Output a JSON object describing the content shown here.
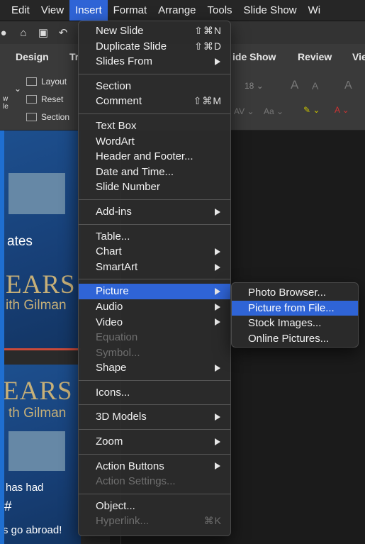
{
  "menubar": {
    "items": [
      "Edit",
      "View",
      "Insert",
      "Format",
      "Arrange",
      "Tools",
      "Slide Show",
      "Wi"
    ],
    "active": "Insert"
  },
  "ribbon": {
    "tabs": [
      "Design",
      "Tr",
      "ide Show",
      "Review",
      "Vie"
    ],
    "buttons": {
      "layout": "Layout",
      "reset": "Reset",
      "section": "Section",
      "new_line1": "w",
      "new_line2": "le"
    },
    "font_size": "18"
  },
  "slides": {
    "slide1_text": "ates",
    "slide1_years": "EARS",
    "slide1_sub": "ith Gilman",
    "slide2_years": "EARS",
    "slide2_sub": "th Gilman",
    "slide2_line1": "has had",
    "slide2_hash": "#",
    "slide2_line2": "s go abroad!"
  },
  "insert_menu": {
    "groups": [
      [
        {
          "label": "New Slide",
          "shortcut": "⇧⌘N"
        },
        {
          "label": "Duplicate Slide",
          "shortcut": "⇧⌘D"
        },
        {
          "label": "Slides From",
          "submenu": true
        }
      ],
      [
        {
          "label": "Section"
        },
        {
          "label": "Comment",
          "shortcut": "⇧⌘M"
        }
      ],
      [
        {
          "label": "Text Box"
        },
        {
          "label": "WordArt"
        },
        {
          "label": "Header and Footer..."
        },
        {
          "label": "Date and Time..."
        },
        {
          "label": "Slide Number"
        }
      ],
      [
        {
          "label": "Add-ins",
          "submenu": true
        }
      ],
      [
        {
          "label": "Table..."
        },
        {
          "label": "Chart",
          "submenu": true
        },
        {
          "label": "SmartArt",
          "submenu": true
        }
      ],
      [
        {
          "label": "Picture",
          "submenu": true,
          "highlight": true
        },
        {
          "label": "Audio",
          "submenu": true
        },
        {
          "label": "Video",
          "submenu": true
        },
        {
          "label": "Equation",
          "disabled": true
        },
        {
          "label": "Symbol...",
          "disabled": true
        },
        {
          "label": "Shape",
          "submenu": true
        }
      ],
      [
        {
          "label": "Icons..."
        }
      ],
      [
        {
          "label": "3D Models",
          "submenu": true
        }
      ],
      [
        {
          "label": "Zoom",
          "submenu": true
        }
      ],
      [
        {
          "label": "Action Buttons",
          "submenu": true
        },
        {
          "label": "Action Settings...",
          "disabled": true
        }
      ],
      [
        {
          "label": "Object..."
        },
        {
          "label": "Hyperlink...",
          "shortcut": "⌘K",
          "disabled": true
        }
      ]
    ]
  },
  "picture_submenu": {
    "items": [
      {
        "label": "Photo Browser..."
      },
      {
        "label": "Picture from File...",
        "highlight": true
      },
      {
        "label": "Stock Images..."
      },
      {
        "label": "Online Pictures..."
      }
    ]
  },
  "colors": {
    "highlight": "#2f64d6",
    "menu_bg": "#2b2b2b",
    "slide_gold": "#c7b078",
    "slide_blue": "#1d4f8e"
  }
}
